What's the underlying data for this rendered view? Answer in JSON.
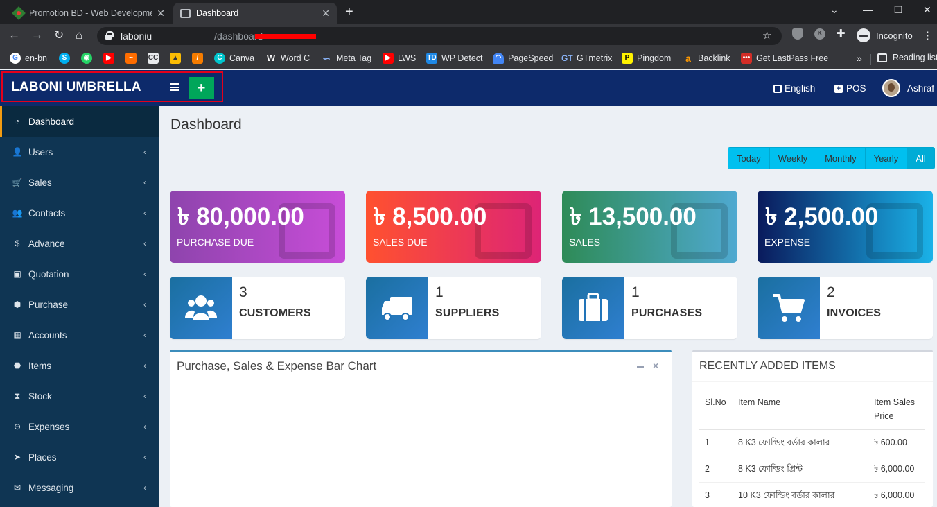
{
  "browser": {
    "tabs": [
      {
        "title": "Promotion BD - Web Developme",
        "active": false
      },
      {
        "title": "Dashboard",
        "active": true
      }
    ],
    "url_host": "laboniu",
    "url_path": "/dashboard",
    "incognito_label": "Incognito",
    "bookmarks": [
      {
        "label": "en-bn",
        "icon": "google-icon"
      },
      {
        "label": "",
        "icon": "skype-icon"
      },
      {
        "label": "",
        "icon": "whatsapp-icon"
      },
      {
        "label": "",
        "icon": "youtube-icon"
      },
      {
        "label": "",
        "icon": "orange-app-icon"
      },
      {
        "label": "",
        "icon": "cc-icon"
      },
      {
        "label": "",
        "icon": "image-icon"
      },
      {
        "label": "",
        "icon": "pen-icon"
      },
      {
        "label": "Canva",
        "icon": "canva-icon"
      },
      {
        "label": "Word C",
        "icon": "w-icon"
      },
      {
        "label": "Meta Tag",
        "icon": "link-icon"
      },
      {
        "label": "LWS",
        "icon": "youtube-icon"
      },
      {
        "label": "WP Detect",
        "icon": "td-icon"
      },
      {
        "label": "PageSpeed",
        "icon": "pagespeed-icon"
      },
      {
        "label": "GTmetrix",
        "icon": "gtmetrix-icon"
      },
      {
        "label": "Pingdom",
        "icon": "pingdom-icon"
      },
      {
        "label": "Backlink",
        "icon": "amazon-icon"
      },
      {
        "label": "Get LastPass Free",
        "icon": "lastpass-icon"
      }
    ],
    "bookmarks_more": "»",
    "reading_list": "Reading list"
  },
  "header": {
    "brand": "LABONI UMBRELLA",
    "add_label": "+",
    "language": "English",
    "pos": "POS",
    "user": "Ashraf"
  },
  "sidebar": {
    "items": [
      {
        "label": "Dashboard",
        "icon": "dashboard-icon",
        "active": true
      },
      {
        "label": "Users",
        "icon": "user-plus-icon"
      },
      {
        "label": "Sales",
        "icon": "cart-icon"
      },
      {
        "label": "Contacts",
        "icon": "users-icon"
      },
      {
        "label": "Advance",
        "icon": "dollar-icon"
      },
      {
        "label": "Quotation",
        "icon": "calendar-plus-icon"
      },
      {
        "label": "Purchase",
        "icon": "cube-icon"
      },
      {
        "label": "Accounts",
        "icon": "grid-icon"
      },
      {
        "label": "Items",
        "icon": "cubes-icon"
      },
      {
        "label": "Stock",
        "icon": "hourglass-icon"
      },
      {
        "label": "Expenses",
        "icon": "minus-circle-icon"
      },
      {
        "label": "Places",
        "icon": "paper-plane-icon"
      },
      {
        "label": "Messaging",
        "icon": "envelope-icon"
      }
    ],
    "chevron": "‹"
  },
  "main": {
    "title": "Dashboard",
    "ranges": [
      "Today",
      "Weekly",
      "Monthly",
      "Yearly",
      "All"
    ],
    "active_range": "All",
    "stats": [
      {
        "amount": "৳ 80,000.00",
        "label": "PURCHASE DUE",
        "colors": [
          "#8e44ad",
          "#c84dd8"
        ]
      },
      {
        "amount": "৳ 8,500.00",
        "label": "SALES DUE",
        "colors": [
          "#ff512f",
          "#dd2476"
        ]
      },
      {
        "amount": "৳ 13,500.00",
        "label": "SALES",
        "colors": [
          "#2e8b57",
          "#4fa9d1"
        ]
      },
      {
        "amount": "৳ 2,500.00",
        "label": "EXPENSE",
        "colors": [
          "#0a1a5c",
          "#1ab2e8"
        ]
      }
    ],
    "counters": [
      {
        "count": "3",
        "label": "CUSTOMERS",
        "icon": "users-icon"
      },
      {
        "count": "1",
        "label": "SUPPLIERS",
        "icon": "truck-icon"
      },
      {
        "count": "1",
        "label": "PURCHASES",
        "icon": "briefcase-icon"
      },
      {
        "count": "2",
        "label": "INVOICES",
        "icon": "cart-icon"
      }
    ],
    "chart_box": {
      "title": "Purchase, Sales & Expense Bar Chart"
    },
    "recent": {
      "title": "RECENTLY ADDED ITEMS",
      "columns": [
        "Sl.No",
        "Item Name",
        "Item Sales Price"
      ],
      "rows": [
        {
          "sl": "1",
          "name": "8 K3 ফোল্ডিং বর্ডার কালার",
          "price": "৳ 600.00"
        },
        {
          "sl": "2",
          "name": "8 K3 ফোল্ডিং প্রিন্ট",
          "price": "৳ 6,000.00"
        },
        {
          "sl": "3",
          "name": "10 K3 ফোল্ডিং বর্ডার কালার",
          "price": "৳ 6,000.00"
        }
      ]
    }
  },
  "colors": {
    "header": "#0d2a6b",
    "sidebar": "#0f3553",
    "accent_green": "#00a65a",
    "range": "#00c0ef"
  }
}
